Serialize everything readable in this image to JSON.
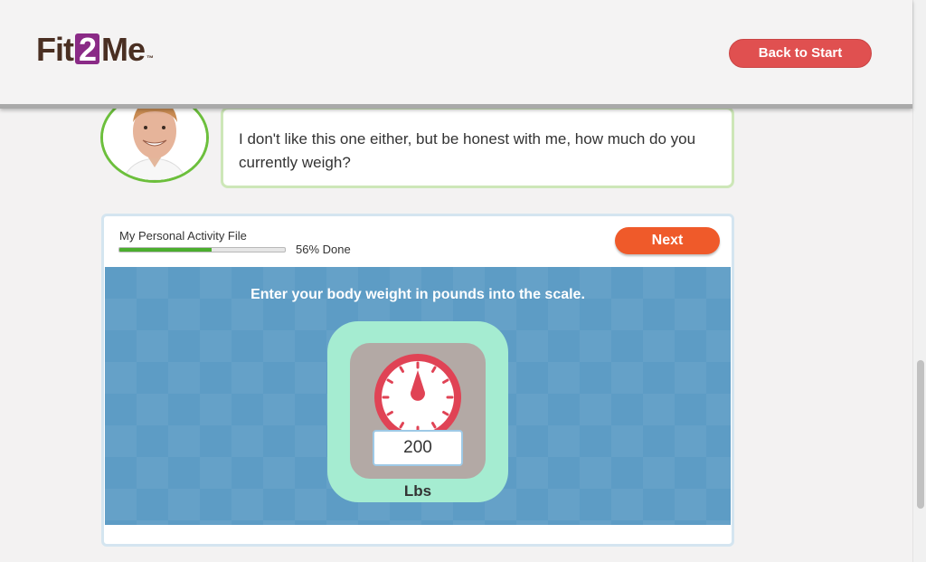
{
  "header": {
    "logo": {
      "before": "Fit",
      "highlight": "2",
      "after": "Me",
      "trademark": "™"
    },
    "back_button": "Back to Start"
  },
  "coach": {
    "message": "I don't like this one either, but be honest with me, how much do you currently weigh?"
  },
  "activity": {
    "title": "My Personal Activity File",
    "progress_percent": 56,
    "progress_label": "56% Done",
    "next_button": "Next",
    "instruction": "Enter your body weight in pounds into the scale.",
    "weight_value": "200",
    "unit": "Lbs"
  },
  "colors": {
    "brand_purple": "#8a2a86",
    "brand_brown": "#4a2f22",
    "back_button": "#e05050",
    "next_button": "#ef5a2a",
    "panel_blue": "#5d9cc5",
    "gauge_red": "#e04355",
    "progress_green": "#4cae2e"
  }
}
